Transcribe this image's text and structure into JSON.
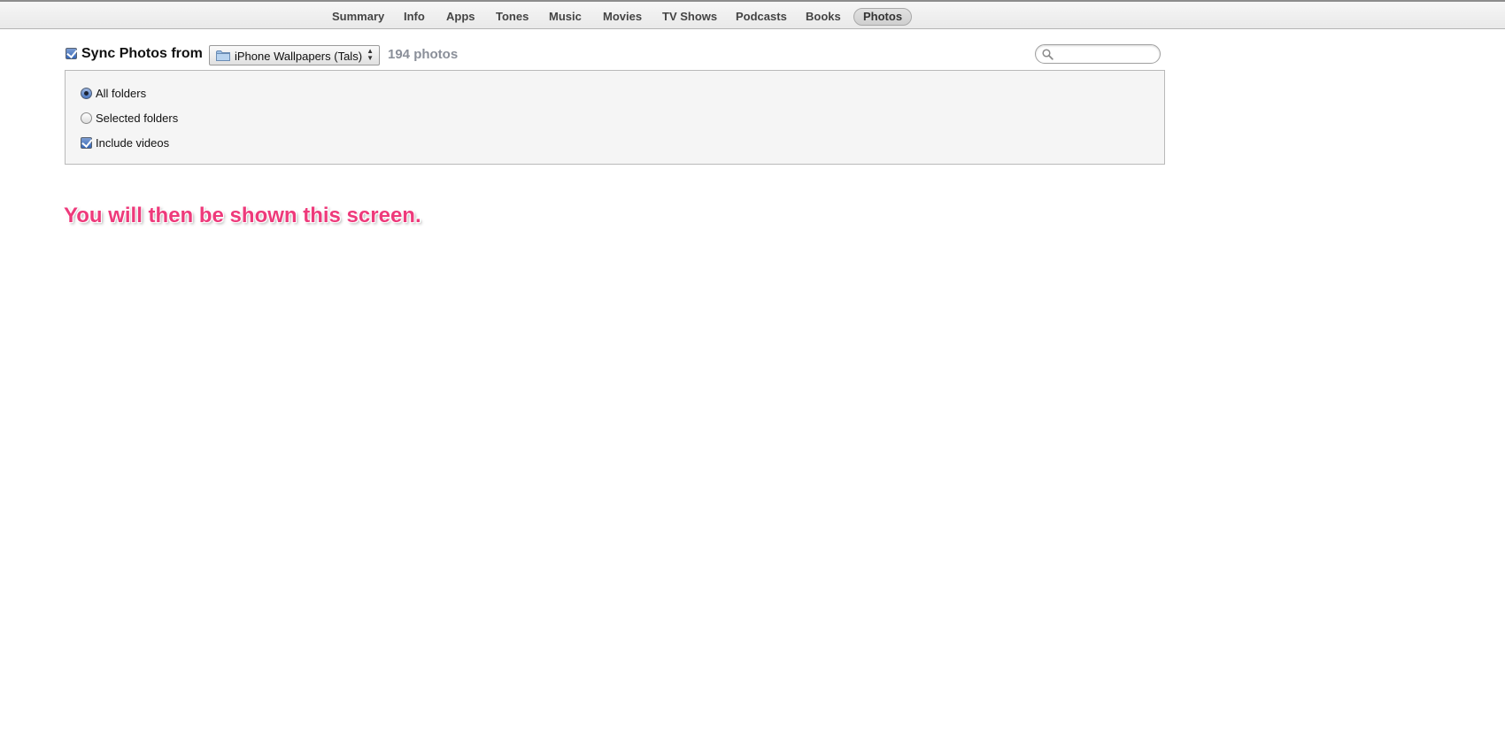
{
  "tabs": [
    {
      "label": "Summary"
    },
    {
      "label": "Info"
    },
    {
      "label": "Apps"
    },
    {
      "label": "Tones"
    },
    {
      "label": "Music"
    },
    {
      "label": "Movies"
    },
    {
      "label": "TV Shows"
    },
    {
      "label": "Podcasts"
    },
    {
      "label": "Books"
    },
    {
      "label": "Photos",
      "active": true
    }
  ],
  "sync": {
    "checked": true,
    "label": "Sync Photos from",
    "source": "iPhone Wallpapers (Tals)",
    "source_icon": "folder-icon",
    "count": "194 photos"
  },
  "search": {
    "value": "",
    "placeholder": "",
    "icon": "search-icon"
  },
  "options": {
    "all_folders": {
      "label": "All folders",
      "selected": true
    },
    "selected_folders": {
      "label": "Selected folders",
      "selected": false
    },
    "include_videos": {
      "label": "Include videos",
      "checked": true
    }
  },
  "caption": "You will then be shown this screen.",
  "colors": {
    "accent": "#3566b6",
    "caption": "#ee3a7b",
    "count": "#8a8f99"
  }
}
